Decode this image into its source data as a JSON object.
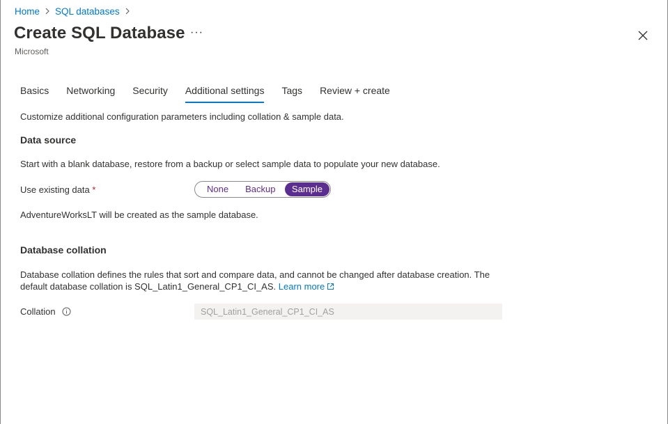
{
  "breadcrumb": {
    "items": [
      "Home",
      "SQL databases"
    ],
    "separator": ">"
  },
  "header": {
    "title": "Create SQL Database",
    "more_label": "···",
    "subtitle": "Microsoft"
  },
  "tabs": [
    {
      "label": "Basics",
      "active": false
    },
    {
      "label": "Networking",
      "active": false
    },
    {
      "label": "Security",
      "active": false
    },
    {
      "label": "Additional settings",
      "active": true
    },
    {
      "label": "Tags",
      "active": false
    },
    {
      "label": "Review + create",
      "active": false
    }
  ],
  "main": {
    "intro": "Customize additional configuration parameters including collation & sample data.",
    "data_source": {
      "heading": "Data source",
      "description": "Start with a blank database, restore from a backup or select sample data to populate your new database.",
      "field_label": "Use existing data",
      "required_marker": "*",
      "options": [
        "None",
        "Backup",
        "Sample"
      ],
      "selected": "Sample",
      "note": "AdventureWorksLT will be created as the sample database."
    },
    "collation": {
      "heading": "Database collation",
      "description_line1": "Database collation defines the rules that sort and compare data, and cannot be changed after database creation. The",
      "description_line2": "default database collation is SQL_Latin1_General_CP1_CI_AS.",
      "learn_more": "Learn more",
      "field_label": "Collation",
      "value": "SQL_Latin1_General_CP1_CI_AS"
    }
  },
  "colors": {
    "accent": "#0078d4",
    "segment_selected": "#5c2d91",
    "required": "#a4262c"
  },
  "icons": {
    "close": "close-icon",
    "info": "info-icon",
    "external": "external-link-icon",
    "chevron": "chevron-right-icon"
  }
}
